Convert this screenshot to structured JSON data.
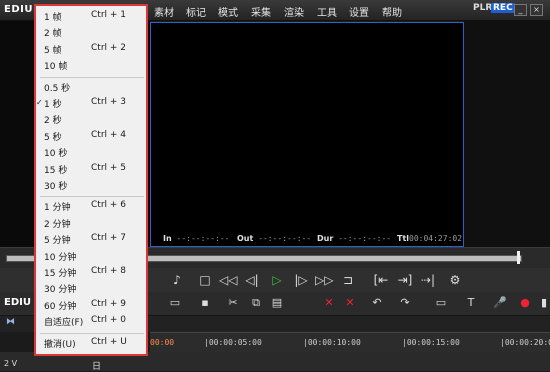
{
  "menubar": {
    "app_title": "EDIU",
    "items": [
      "素材",
      "标记",
      "模式",
      "采集",
      "渲染",
      "工具",
      "设置",
      "帮助"
    ],
    "plr": "PLR",
    "rec": "REC"
  },
  "timecodes": {
    "in_label": "In",
    "in_value": "--:--:--:--",
    "out_label": "Out",
    "out_value": "--:--:--:--",
    "dur_label": "Dur",
    "dur_value": "--:--:--:--",
    "ttl_label": "Ttl",
    "ttl_value": "00:04:27:02"
  },
  "lower_left": {
    "label": "EDIU",
    "track_number": "2 V",
    "track_suffix": "日"
  },
  "ruler": {
    "labels": [
      "00:00",
      "|00:00:05:00",
      "|00:00:10:00",
      "|00:00:15:00",
      "|00:00:20:00"
    ]
  },
  "dropdown": {
    "groups": [
      [
        {
          "label": "1 帧",
          "shortcut": "Ctrl + 1"
        },
        {
          "label": "2 帧",
          "shortcut": ""
        },
        {
          "label": "5 帧",
          "shortcut": "Ctrl + 2"
        },
        {
          "label": "10 帧",
          "shortcut": ""
        }
      ],
      [
        {
          "label": "0.5 秒",
          "shortcut": ""
        },
        {
          "label": "1 秒",
          "shortcut": "Ctrl + 3",
          "checked": true
        },
        {
          "label": "2 秒",
          "shortcut": ""
        },
        {
          "label": "5 秒",
          "shortcut": "Ctrl + 4"
        },
        {
          "label": "10 秒",
          "shortcut": ""
        },
        {
          "label": "15 秒",
          "shortcut": "Ctrl + 5"
        },
        {
          "label": "30 秒",
          "shortcut": ""
        }
      ],
      [
        {
          "label": "1 分钟",
          "shortcut": "Ctrl + 6"
        },
        {
          "label": "2 分钟",
          "shortcut": ""
        },
        {
          "label": "5 分钟",
          "shortcut": "Ctrl + 7"
        },
        {
          "label": "10 分钟",
          "shortcut": ""
        },
        {
          "label": "15 分钟",
          "shortcut": "Ctrl + 8"
        },
        {
          "label": "30 分钟",
          "shortcut": ""
        },
        {
          "label": "60 分钟",
          "shortcut": "Ctrl + 9"
        },
        {
          "label": "自适应(F)",
          "shortcut": "Ctrl + 0"
        }
      ],
      [
        {
          "label": "撤消(U)",
          "shortcut": "Ctrl + U"
        }
      ]
    ]
  },
  "colors": {
    "accent": "#1f5fd0",
    "menu_border": "#d83a3a",
    "play": "#37c437"
  },
  "icons": {
    "transport": [
      "mark-icon",
      "stop-icon",
      "rewind-icon",
      "step-back-icon",
      "play-icon",
      "step-forward-icon",
      "fast-forward-icon",
      "loop-icon",
      "in-point-icon",
      "split-icon",
      "out-point-icon",
      "settings-icon"
    ],
    "toolbar": [
      "open-icon",
      "save-icon",
      "cut-icon",
      "copy-icon",
      "paste-icon",
      "delete-icon",
      "undo-icon",
      "redo-icon",
      "link-icon",
      "title-icon",
      "mic-icon",
      "audio-icon"
    ]
  }
}
